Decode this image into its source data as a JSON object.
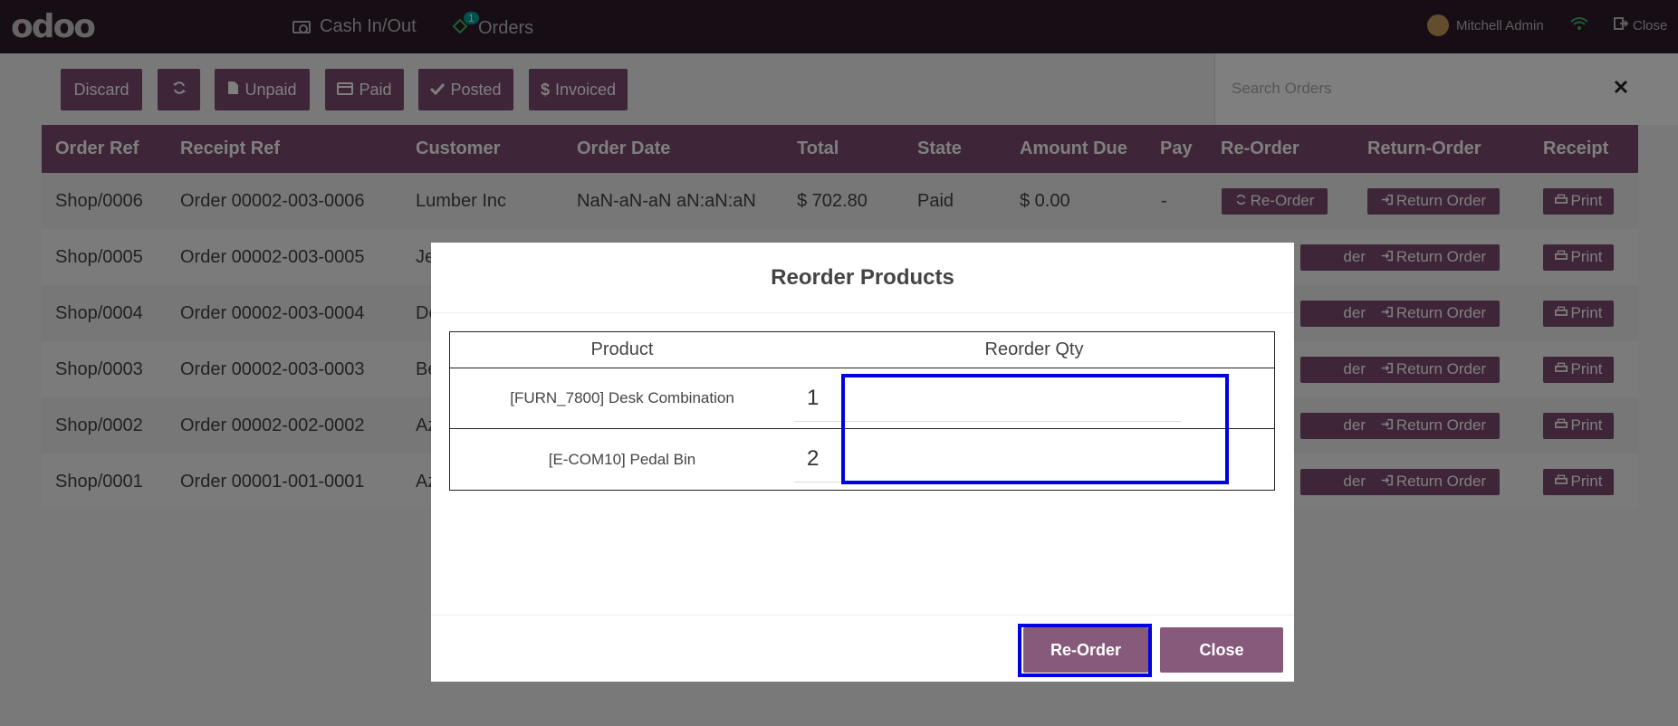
{
  "topbar": {
    "logo": "odoo",
    "cash_label": "Cash In/Out",
    "orders_label": "Orders",
    "orders_badge": "1",
    "user_name": "Mitchell Admin",
    "close_label": "Close"
  },
  "toolbar": {
    "discard": "Discard",
    "unpaid": "Unpaid",
    "paid": "Paid",
    "posted": "Posted",
    "invoiced": "Invoiced",
    "search_placeholder": "Search Orders"
  },
  "table": {
    "headers": {
      "order_ref": "Order Ref",
      "receipt_ref": "Receipt Ref",
      "customer": "Customer",
      "order_date": "Order Date",
      "total": "Total",
      "state": "State",
      "amount_due": "Amount Due",
      "pay": "Pay",
      "reorder": "Re-Order",
      "return_order": "Return-Order",
      "receipt": "Receipt"
    },
    "rows": [
      {
        "order_ref": "Shop/0006",
        "receipt_ref": "Order 00002-003-0006",
        "customer": "Lumber Inc",
        "order_date": "NaN-aN-aN aN:aN:aN",
        "total": "$ 702.80",
        "state": "Paid",
        "amount_due": "$ 0.00",
        "pay": "-",
        "reorder": "Re-Order",
        "return": "Return Order",
        "print": "Print"
      },
      {
        "order_ref": "Shop/0005",
        "receipt_ref": "Order 00002-003-0005",
        "customer": "Je",
        "order_date": "",
        "total": "",
        "state": "",
        "amount_due": "",
        "pay": "",
        "reorder": "der",
        "return": "Return Order",
        "print": "Print"
      },
      {
        "order_ref": "Shop/0004",
        "receipt_ref": "Order 00002-003-0004",
        "customer": "De",
        "order_date": "",
        "total": "",
        "state": "",
        "amount_due": "",
        "pay": "",
        "reorder": "der",
        "return": "Return Order",
        "print": "Print"
      },
      {
        "order_ref": "Shop/0003",
        "receipt_ref": "Order 00002-003-0003",
        "customer": "Be",
        "order_date": "",
        "total": "",
        "state": "",
        "amount_due": "",
        "pay": "",
        "reorder": "der",
        "return": "Return Order",
        "print": "Print"
      },
      {
        "order_ref": "Shop/0002",
        "receipt_ref": "Order 00002-002-0002",
        "customer": "Az",
        "order_date": "",
        "total": "",
        "state": "",
        "amount_due": "",
        "pay": "",
        "reorder": "der",
        "return": "Return Order",
        "print": "Print"
      },
      {
        "order_ref": "Shop/0001",
        "receipt_ref": "Order 00001-001-0001",
        "customer": "Az",
        "order_date": "",
        "total": "",
        "state": "",
        "amount_due": "",
        "pay": "",
        "reorder": "der",
        "return": "Return Order",
        "print": "Print"
      }
    ]
  },
  "modal": {
    "title": "Reorder Products",
    "col_product": "Product",
    "col_qty": "Reorder Qty",
    "lines": [
      {
        "product": "[FURN_7800] Desk Combination",
        "qty": "1"
      },
      {
        "product": "[E-COM10] Pedal Bin",
        "qty": "2"
      }
    ],
    "reorder_button": "Re-Order",
    "close_button": "Close"
  },
  "colors": {
    "brand": "#7c4b6e",
    "topbar": "#2f1b2b",
    "highlight": "#0000e0"
  }
}
